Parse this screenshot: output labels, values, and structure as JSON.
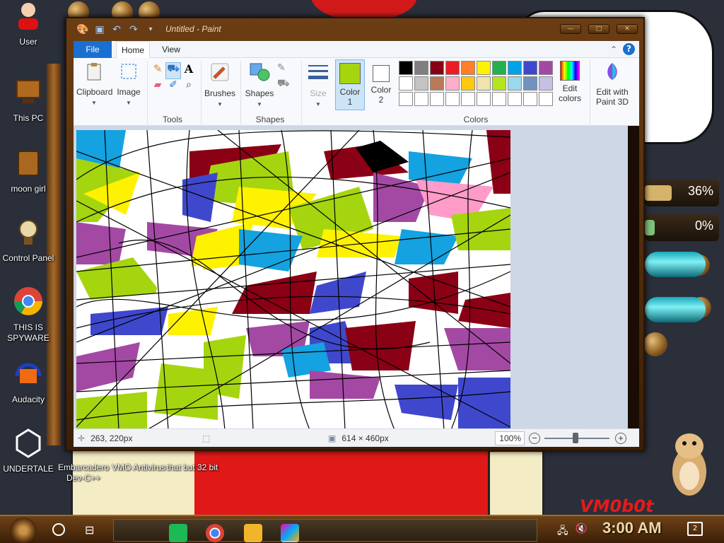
{
  "desktop": {
    "icons": [
      {
        "name": "User"
      },
      {
        "name": "This PC"
      },
      {
        "name": "moon girl"
      },
      {
        "name": "Control Panel"
      },
      {
        "name": "THIS IS SPYWARE"
      },
      {
        "name": "Audacity"
      },
      {
        "name": "UNDERTALE"
      },
      {
        "name": "Embarcadero Dev-C++"
      },
      {
        "name": "VMO Antivirus"
      },
      {
        "name": "that but 32 bit"
      }
    ],
    "meters": [
      {
        "label": "36%",
        "value": 0.36
      },
      {
        "label": "0%",
        "value": 0.0
      }
    ],
    "wallpaper_text": "VM0b0t"
  },
  "paint": {
    "title": "Untitled - Paint",
    "tabs": {
      "file": "File",
      "home": "Home",
      "view": "View"
    },
    "help": "?",
    "ribbon": {
      "clipboard": "Clipboard",
      "image": "Image",
      "tools": "Tools",
      "brushes": "Brushes",
      "shapes": "Shapes",
      "shapes_group": "Shapes",
      "size": "Size",
      "color1": "Color 1",
      "color2": "Color 2",
      "colors_group": "Colors",
      "edit_colors": "Edit colors",
      "paint3d": "Edit with Paint 3D"
    },
    "color1": "#a5d50f",
    "color2": "#ffffff",
    "palette": [
      "#000000",
      "#7f7f7f",
      "#880015",
      "#ed1c24",
      "#ff7f27",
      "#fff200",
      "#22b14c",
      "#00a2e8",
      "#3f48cc",
      "#a349a4",
      "#ffffff",
      "#c3c3c3",
      "#b97a57",
      "#ffaec9",
      "#ffc90e",
      "#efe4b0",
      "#b5e61d",
      "#99d9ea",
      "#7092be",
      "#c8bfe7",
      "#ffffff",
      "#ffffff",
      "#ffffff",
      "#ffffff",
      "#ffffff",
      "#ffffff",
      "#ffffff",
      "#ffffff",
      "#ffffff",
      "#ffffff"
    ],
    "status": {
      "position": "263, 220px",
      "size": "614 × 460px",
      "zoom": "100%"
    }
  },
  "taskbar": {
    "clock": "3:00 AM",
    "notifications": "2"
  },
  "icons": [
    "save-icon",
    "undo-icon",
    "redo-icon",
    "pencil-icon",
    "fill-icon",
    "text-icon",
    "eraser-icon",
    "color-picker-icon",
    "magnifier-icon",
    "search-icon",
    "task-view-icon",
    "network-icon",
    "volume-muted-icon",
    "notification-icon"
  ]
}
